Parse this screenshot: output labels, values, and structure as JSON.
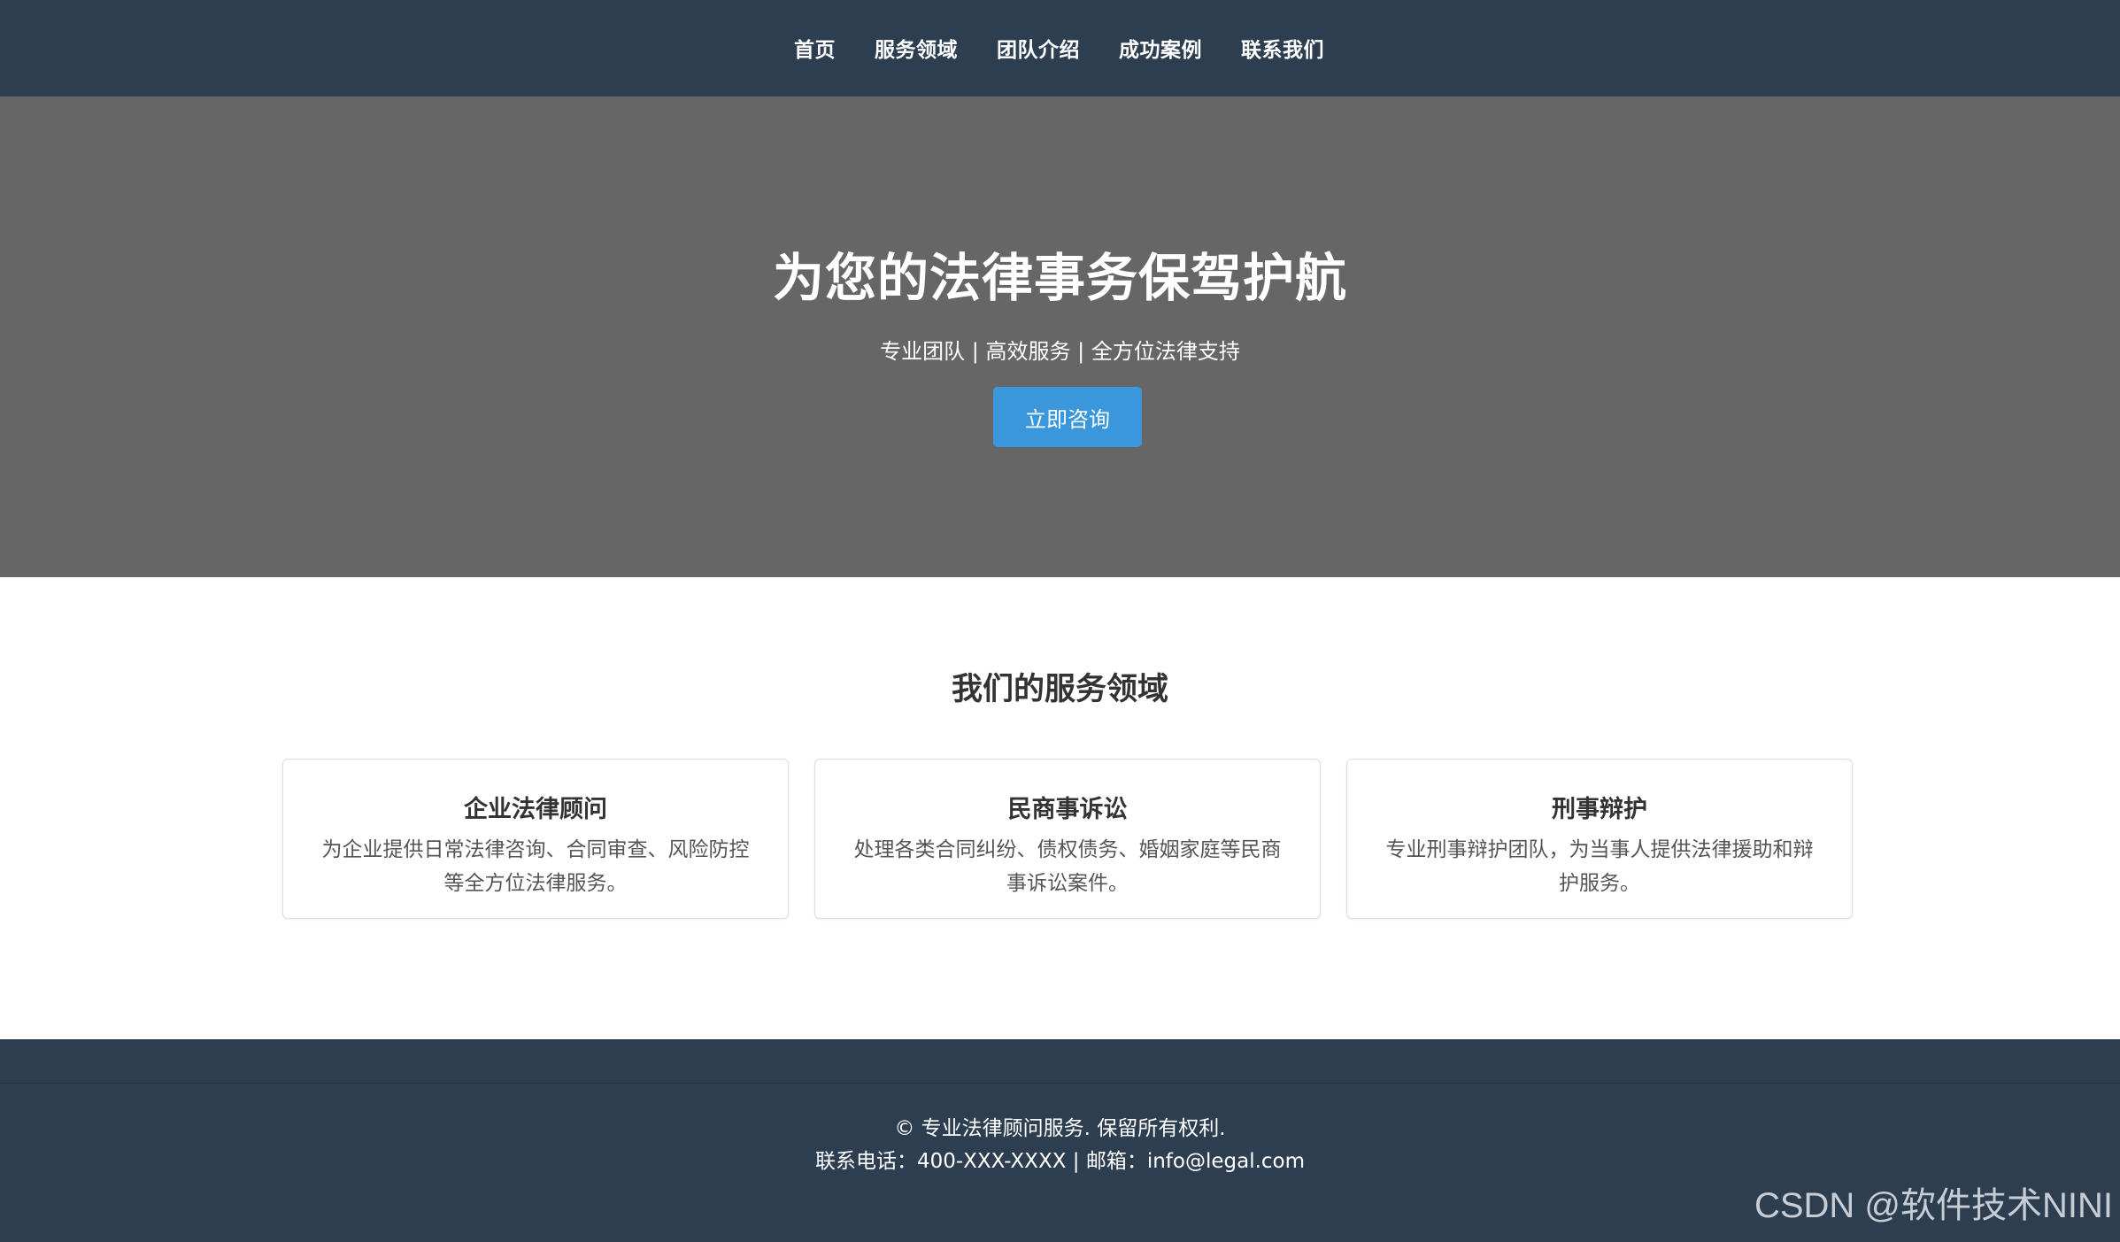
{
  "nav": {
    "items": [
      {
        "label": "首页"
      },
      {
        "label": "服务领域"
      },
      {
        "label": "团队介绍"
      },
      {
        "label": "成功案例"
      },
      {
        "label": "联系我们"
      }
    ]
  },
  "hero": {
    "title": "为您的法律事务保驾护航",
    "subtitle": "专业团队 | 高效服务 | 全方位法律支持",
    "cta_label": "立即咨询"
  },
  "services": {
    "section_title": "我们的服务领域",
    "cards": [
      {
        "title": "企业法律顾问",
        "desc_line1": "为企业提供日常法律咨询、合同审查、风险防控",
        "desc_line2": "等全方位法律服务。"
      },
      {
        "title": "民商事诉讼",
        "desc_line1": "处理各类合同纠纷、债权债务、婚姻家庭等民商",
        "desc_line2": "事诉讼案件。"
      },
      {
        "title": "刑事辩护",
        "desc_line1": "专业刑事辩护团队，为当事人提供法律援助和辩",
        "desc_line2": "护服务。"
      }
    ]
  },
  "footer": {
    "copyright": "© 专业法律顾问服务. 保留所有权利.",
    "contact": "联系电话：400-XXX-XXXX | 邮箱：info@legal.com"
  },
  "watermark": "CSDN @软件技术NINI",
  "colors": {
    "nav_bg": "#2e3e51",
    "hero_bg": "#666666",
    "accent": "#3a97dc",
    "footer_bg": "#2e3e51"
  }
}
